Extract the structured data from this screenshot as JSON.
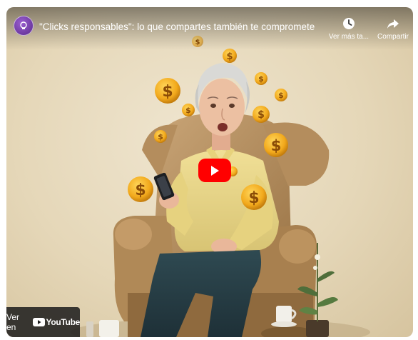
{
  "header": {
    "title": "\"Clicks responsables\": lo que compartes también te compromete",
    "watch_later_label": "Ver más ta...",
    "share_label": "Compartir"
  },
  "badge": {
    "prefix": "Ver en",
    "brand": "YouTube"
  },
  "icons": {
    "avatar": "channel-avatar",
    "clock": "clock-icon",
    "share": "share-arrow-icon",
    "play": "play-icon",
    "youtube": "youtube-logo-icon"
  },
  "colors": {
    "play_button": "#ff0000",
    "badge_bg": "#1c1c1c",
    "coin": "#f2a91c"
  }
}
